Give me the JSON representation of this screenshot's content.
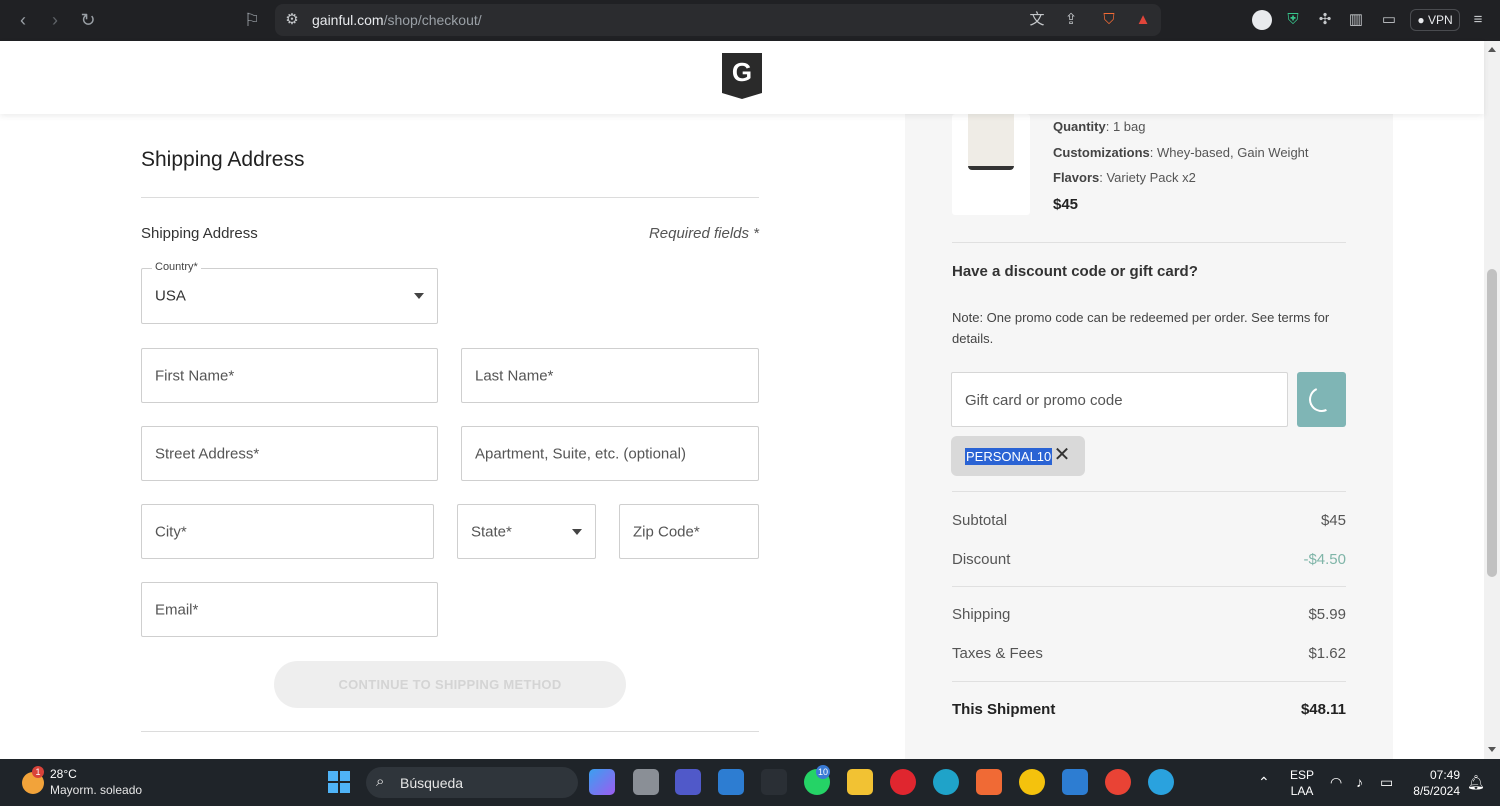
{
  "browser": {
    "url_host": "gainful.com",
    "url_path": "/shop/checkout/",
    "vpn_label": "VPN"
  },
  "brand": {
    "logo_letter": "G"
  },
  "form": {
    "page_title": "Shipping Address",
    "section_title": "Shipping Address",
    "required_note": "Required fields *",
    "country_label": "Country*",
    "country_value": "USA",
    "first_name_placeholder": "First Name*",
    "last_name_placeholder": "Last Name*",
    "street_placeholder": "Street Address*",
    "apartment_placeholder": "Apartment, Suite, etc. (optional)",
    "city_placeholder": "City*",
    "state_placeholder": "State*",
    "zip_placeholder": "Zip Code*",
    "email_placeholder": "Email*",
    "continue_label": "CONTINUE TO SHIPPING METHOD"
  },
  "summary": {
    "product": {
      "quantity_label": "Quantity",
      "quantity_value": ": 1 bag",
      "customizations_label": "Customizations",
      "customizations_value": ": Whey-based, Gain Weight",
      "flavors_label": "Flavors",
      "flavors_value": ": Variety Pack x2",
      "price": "$45"
    },
    "discount_title": "Have a discount code or gift card?",
    "discount_note": "Note: One promo code can be redeemed per order. See terms for details.",
    "promo_placeholder": "Gift card or promo code",
    "applied_code": "PERSONAL10",
    "rows": {
      "subtotal_label": "Subtotal",
      "subtotal_value": "$45",
      "discount_label": "Discount",
      "discount_value": "-$4.50",
      "shipping_label": "Shipping",
      "shipping_value": "$5.99",
      "taxes_label": "Taxes & Fees",
      "taxes_value": "$1.62",
      "shipment_label": "This Shipment",
      "shipment_value": "$48.11"
    }
  },
  "taskbar": {
    "weather_badge": "1",
    "weather_temp": "28°C",
    "weather_desc": "Mayorm. soleado",
    "search_label": "Búsqueda",
    "whatsapp_badge": "10",
    "lang_top": "ESP",
    "lang_bottom": "LAA",
    "time": "07:49",
    "date": "8/5/2024"
  }
}
